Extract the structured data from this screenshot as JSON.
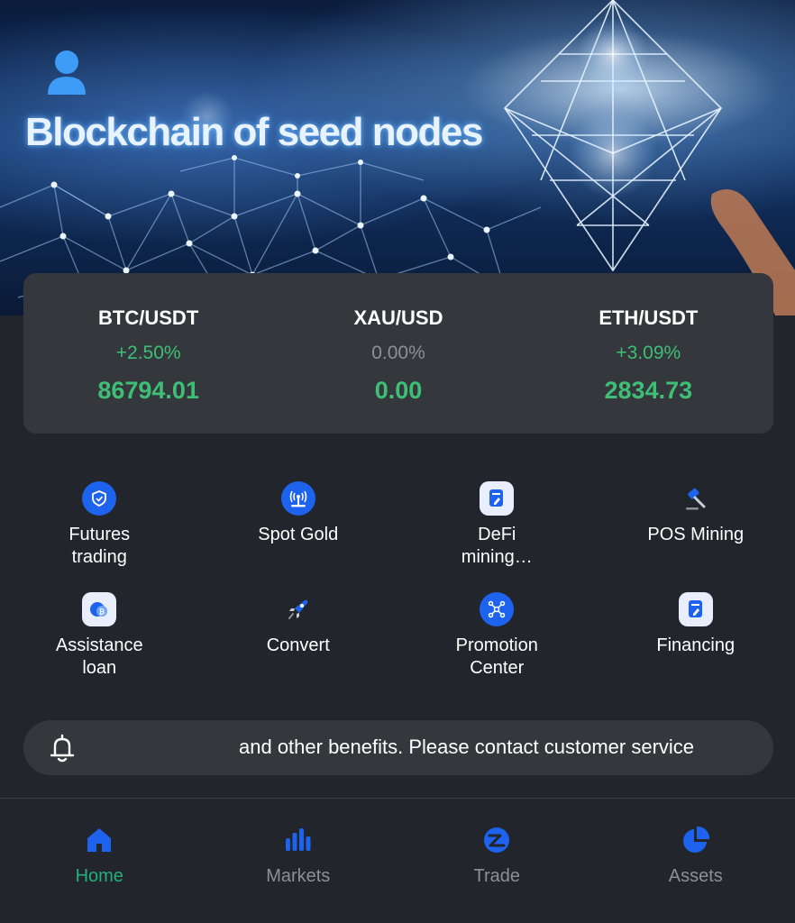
{
  "banner": {
    "title": "Blockchain of seed nodes"
  },
  "tickers": [
    {
      "pair": "BTC/USDT",
      "change": "+2.50%",
      "price": "86794.01",
      "trend": "up"
    },
    {
      "pair": "XAU/USD",
      "change": "0.00%",
      "price": "0.00",
      "trend": "flat"
    },
    {
      "pair": "ETH/USDT",
      "change": "+3.09%",
      "price": "2834.73",
      "trend": "up"
    }
  ],
  "menu": [
    {
      "label": "Futures trading",
      "icon": "shield-icon"
    },
    {
      "label": "Spot Gold",
      "icon": "signal-icon"
    },
    {
      "label": "DeFi mining…",
      "icon": "document-edit-icon"
    },
    {
      "label": "POS Mining",
      "icon": "hammer-icon"
    },
    {
      "label": "Assistance loan",
      "icon": "coin-icon"
    },
    {
      "label": "Convert",
      "icon": "rocket-icon"
    },
    {
      "label": "Promotion Center",
      "icon": "network-icon"
    },
    {
      "label": "Financing",
      "icon": "document-edit-icon"
    }
  ],
  "notice": {
    "text": "and other benefits. Please contact customer service"
  },
  "nav": [
    {
      "label": "Home",
      "icon": "home-icon",
      "active": true
    },
    {
      "label": "Markets",
      "icon": "bar-chart-icon",
      "active": false
    },
    {
      "label": "Trade",
      "icon": "trade-icon",
      "active": false
    },
    {
      "label": "Assets",
      "icon": "pie-chart-icon",
      "active": false
    }
  ],
  "colors": {
    "background": "#22252b",
    "card": "#34383c",
    "up": "#3fbf76",
    "flat": "#8c9096",
    "accent_blue": "#1e63ee",
    "nav_active": "#23b07b"
  }
}
